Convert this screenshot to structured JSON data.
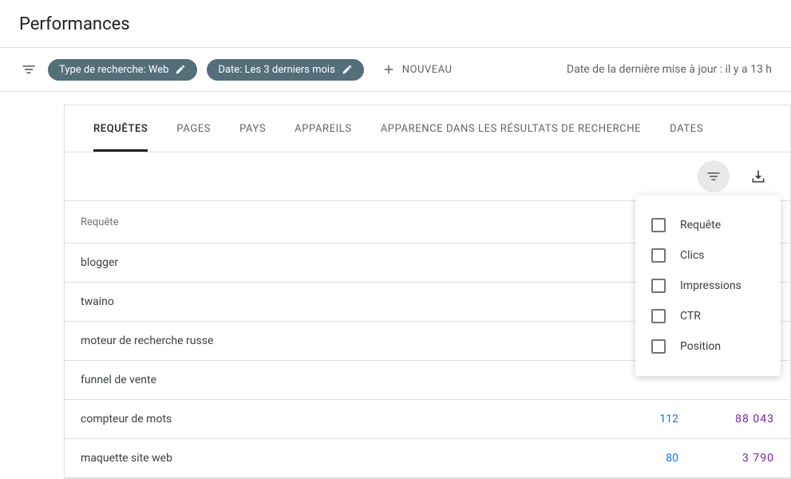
{
  "header": {
    "title": "Performances"
  },
  "filters": {
    "chip1": "Type de recherche: Web",
    "chip2": "Date: Les 3 derniers mois",
    "new_label": "NOUVEAU",
    "update_text": "Date de la dernière mise à jour : il y a 13 h"
  },
  "tabs": [
    {
      "label": "REQUÊTES"
    },
    {
      "label": "PAGES"
    },
    {
      "label": "PAYS"
    },
    {
      "label": "APPAREILS"
    },
    {
      "label": "APPARENCE DANS LES RÉSULTATS DE RECHERCHE"
    },
    {
      "label": "DATES"
    }
  ],
  "table": {
    "header_query": "Requête",
    "rows": [
      {
        "query": "blogger",
        "clicks": "",
        "impressions": ""
      },
      {
        "query": "twaino",
        "clicks": "",
        "impressions": ""
      },
      {
        "query": "moteur de recherche russe",
        "clicks": "",
        "impressions": ""
      },
      {
        "query": "funnel de vente",
        "clicks": "",
        "impressions": ""
      },
      {
        "query": "compteur de mots",
        "clicks": "112",
        "impressions": "88 043"
      },
      {
        "query": "maquette site web",
        "clicks": "80",
        "impressions": "3 790"
      }
    ]
  },
  "dropdown": {
    "items": [
      {
        "label": "Requête"
      },
      {
        "label": "Clics"
      },
      {
        "label": "Impressions"
      },
      {
        "label": "CTR"
      },
      {
        "label": "Position"
      }
    ]
  }
}
